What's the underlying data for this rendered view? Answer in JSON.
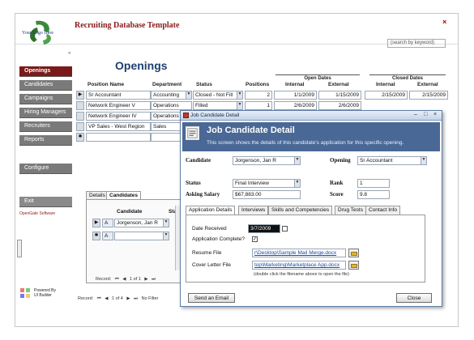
{
  "app": {
    "title": "Recruiting Database Template",
    "logo_text": "Your Logo Here",
    "search_placeholder": "(search by keyword)",
    "close_glyph": "×"
  },
  "sidebar": {
    "collapse_glyph": "«",
    "items": [
      {
        "label": "Openings"
      },
      {
        "label": "Candidates"
      },
      {
        "label": "Campaigns"
      },
      {
        "label": "Hiring Managers"
      },
      {
        "label": "Recruiters"
      },
      {
        "label": "Reports"
      },
      {
        "label": "Configure"
      },
      {
        "label": "Exit"
      }
    ],
    "link": "OpenGate Software",
    "powered_line1": "Powered By",
    "powered_line2": "UI Builder"
  },
  "openings": {
    "title": "Openings",
    "group_headers": {
      "open": "Open Dates",
      "closed": "Closed Dates"
    },
    "columns": {
      "position": "Position Name",
      "department": "Department",
      "status": "Status",
      "positions": "Positions",
      "open_internal": "Internal",
      "open_external": "External",
      "closed_internal": "Internal",
      "closed_external": "External"
    },
    "rows": [
      {
        "position": "Sr Accountant",
        "department": "Accounting",
        "status": "Closed - Not Fill",
        "positions": "2",
        "open_internal": "1/1/2009",
        "open_external": "1/15/2009",
        "closed_internal": "2/15/2009",
        "closed_external": "2/15/2009"
      },
      {
        "position": "Network Engineer V",
        "department": "Operations",
        "status": "Filled",
        "positions": "1",
        "open_internal": "2/6/2009",
        "open_external": "2/6/2009",
        "closed_internal": "",
        "closed_external": ""
      },
      {
        "position": "Network Engineer IV",
        "department": "Operations",
        "status": "",
        "positions": "",
        "open_internal": "",
        "open_external": "",
        "closed_internal": "",
        "closed_external": ""
      },
      {
        "position": "VP Sales - West Region",
        "department": "Sales",
        "status": "",
        "positions": "",
        "open_internal": "",
        "open_external": "",
        "closed_internal": "",
        "closed_external": ""
      }
    ],
    "subtabs": {
      "details": "Details",
      "candidates": "Candidates"
    },
    "sub_headers": {
      "candidate": "Candidate",
      "status": "Sta"
    },
    "sub_rows": [
      {
        "candidate": "Jorgenson, Jan R"
      },
      {
        "candidate": ""
      }
    ],
    "sub_record": {
      "label": "Record:",
      "pos": "1 of 1"
    },
    "main_record": {
      "label": "Record:",
      "pos": "1 of 4",
      "nofilter": "No Filter"
    }
  },
  "dialog": {
    "window_title": "Job Candidate Detail",
    "min": "–",
    "max": "□",
    "close": "×",
    "header_title": "Job Candidate Detail",
    "header_subtitle": "This screen shows the details of this candidate's application for this specific opening.",
    "fields": {
      "candidate_label": "Candidate",
      "candidate_value": "Jorgenson, Jan R",
      "opening_label": "Opening",
      "opening_value": "Sr Accountant",
      "status_label": "Status",
      "status_value": "Final Interview",
      "rank_label": "Rank",
      "rank_value": "1",
      "salary_label": "Asking Salary",
      "salary_value": "$67,883.00",
      "score_label": "Score",
      "score_value": "9.8"
    },
    "tabs": [
      {
        "label": "Application Details"
      },
      {
        "label": "Interviews"
      },
      {
        "label": "Skills and Competencies"
      },
      {
        "label": "Drug Tests"
      },
      {
        "label": "Contact Info"
      }
    ],
    "details": {
      "date_received_label": "Date Received",
      "date_received_value": "3/7/2009",
      "complete_label": "Application Complete?",
      "complete_glyph": "✓",
      "resume_label": "Resume File",
      "resume_value": "r\\Desktop\\Sample Mail Merge.docx",
      "cover_label": "Cover Letter File",
      "cover_value": "top\\Marketing\\Marketplace App.docx",
      "note": "(double click the filename above to open the file)"
    },
    "buttons": {
      "send_email": "Send an Email",
      "close": "Close"
    }
  },
  "colors": {
    "accent": "#7a1a1a",
    "nav_bg": "#7a7a7a",
    "dialog_header": "#4a6895",
    "title_blue": "#1e3f6e"
  }
}
